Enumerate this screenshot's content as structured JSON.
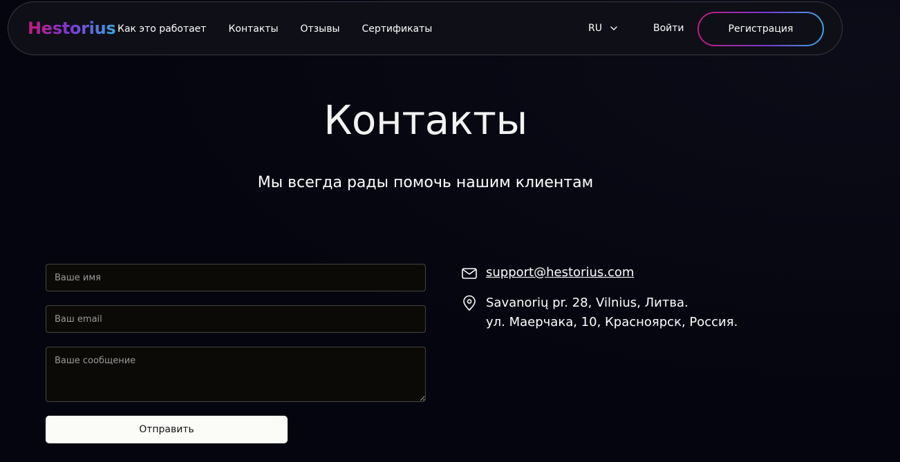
{
  "header": {
    "logo": "Hestorius",
    "nav": [
      "Как это работает",
      "Контакты",
      "Отзывы",
      "Сертификаты"
    ],
    "language": "RU",
    "login_label": "Войти",
    "register_label": "Регистрация"
  },
  "hero": {
    "title": "Контакты",
    "subtitle": "Мы всегда рады помочь нашим клиентам"
  },
  "form": {
    "name_placeholder": "Ваше имя",
    "email_placeholder": "Ваш email",
    "message_placeholder": "Ваше сообщение",
    "name_value": "",
    "email_value": "",
    "message_value": "",
    "submit_label": "Отправить"
  },
  "contacts": {
    "email": "support@hestorius.com",
    "address_lines": [
      "Savanorių pr. 28, Vilnius, Литва.",
      "ул. Маерчака, 10, Красноярск, Россия."
    ]
  },
  "colors": {
    "background": "#05050f",
    "header_bg": "#0f0f17",
    "gradient_start": "#c21b7a",
    "gradient_mid": "#7a3ad8",
    "gradient_end": "#3aa8e0",
    "button_bg": "#fbfbf8"
  },
  "icons": [
    "chevron-down-icon",
    "mail-icon",
    "location-pin-icon"
  ]
}
